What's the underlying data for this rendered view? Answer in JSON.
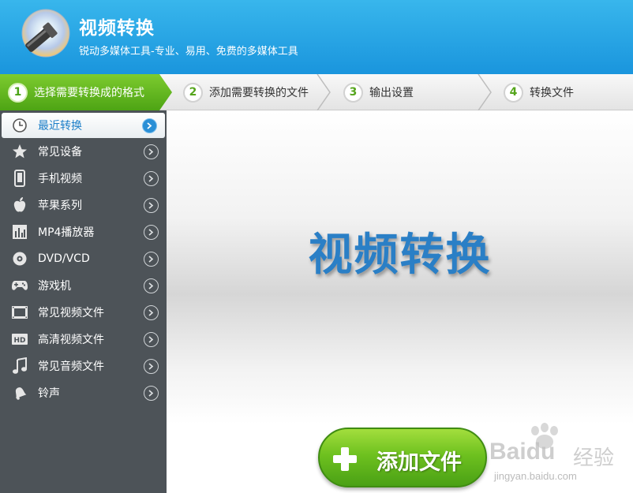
{
  "header": {
    "title": "视频转换",
    "subtitle": "锐动多媒体工具-专业、易用、免费的多媒体工具",
    "logo_icon": "flashlight-disc-icon"
  },
  "steps": [
    {
      "number": "1",
      "label": "选择需要转换成的格式",
      "active": true
    },
    {
      "number": "2",
      "label": "添加需要转换的文件",
      "active": false
    },
    {
      "number": "3",
      "label": "输出设置",
      "active": false
    },
    {
      "number": "4",
      "label": "转换文件",
      "active": false
    }
  ],
  "sidebar": {
    "items": [
      {
        "label": "最近转换",
        "icon": "clock-icon",
        "active": true
      },
      {
        "label": "常见设备",
        "icon": "star-icon",
        "active": false
      },
      {
        "label": "手机视频",
        "icon": "phone-icon",
        "active": false
      },
      {
        "label": "苹果系列",
        "icon": "apple-icon",
        "active": false
      },
      {
        "label": "MP4播放器",
        "icon": "mp4-player-icon",
        "active": false
      },
      {
        "label": "DVD/VCD",
        "icon": "disc-icon",
        "active": false
      },
      {
        "label": "游戏机",
        "icon": "gamepad-icon",
        "active": false
      },
      {
        "label": "常见视频文件",
        "icon": "film-icon",
        "active": false
      },
      {
        "label": "高清视频文件",
        "icon": "hd-icon",
        "active": false
      },
      {
        "label": "常见音频文件",
        "icon": "music-note-icon",
        "active": false
      },
      {
        "label": "铃声",
        "icon": "bell-icon",
        "active": false
      }
    ]
  },
  "main": {
    "title": "视频转换",
    "add_button_label": "添加文件"
  },
  "watermark": {
    "brand": "Baidu",
    "brand_suffix": "经验",
    "url": "jingyan.baidu.com"
  },
  "colors": {
    "header_blue": "#1a95dd",
    "active_step_green": "#5cb61a",
    "sidebar_bg": "#4d5358",
    "title_blue": "#2a7fc6",
    "button_green": "#6ec11f"
  }
}
